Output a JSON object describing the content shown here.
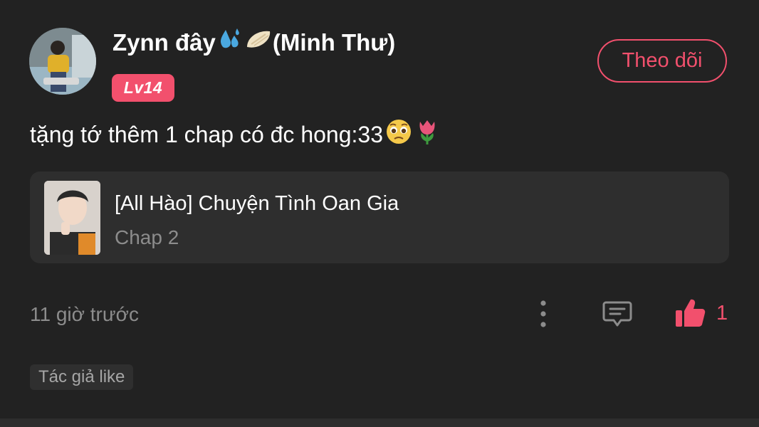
{
  "comment": {
    "user": {
      "name_prefix": "Zynn đây",
      "name_suffix": "(Minh Thư)",
      "name_emojis": [
        "sweat-droplets-icon",
        "dumpling-icon"
      ],
      "level": "Lv14"
    },
    "follow_label": "Theo dõi",
    "text": "tặng tớ thêm 1 chap có đc hong:33",
    "text_emojis": [
      "pleading-face-icon",
      "tulip-icon"
    ],
    "story": {
      "title": "[All Hào] Chuyện Tình Oan Gia",
      "chapter": "Chap 2"
    },
    "timestamp": "11 giờ trước",
    "like_count": "1",
    "author_like_tag": "Tác giả like"
  },
  "colors": {
    "background": "#222222",
    "accent": "#f2506d",
    "card": "#2e2e2e",
    "muted_text": "#8c8c8c"
  }
}
